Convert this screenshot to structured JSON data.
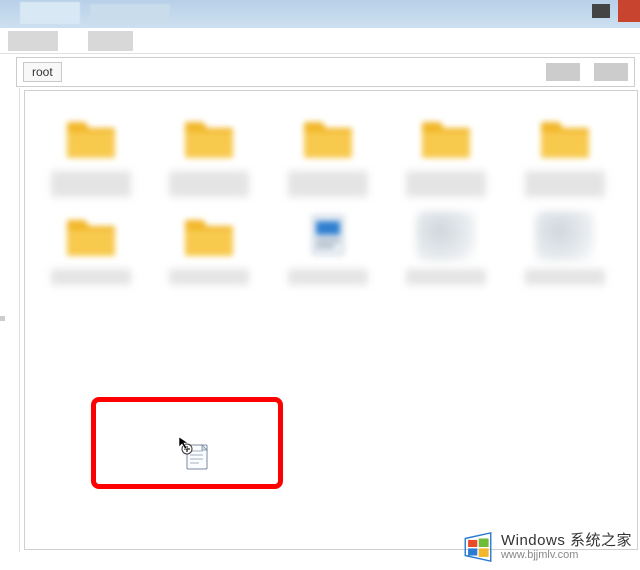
{
  "breadcrumb": {
    "root_label": "root"
  },
  "items": [
    {
      "kind": "folder",
      "label": ""
    },
    {
      "kind": "folder",
      "label": ""
    },
    {
      "kind": "folder",
      "label": ""
    },
    {
      "kind": "folder",
      "label": ""
    },
    {
      "kind": "folder",
      "label": ""
    },
    {
      "kind": "folder",
      "label": ""
    },
    {
      "kind": "folder",
      "label": ""
    },
    {
      "kind": "blue-doc",
      "label": ""
    },
    {
      "kind": "grey",
      "label": ""
    },
    {
      "kind": "grey",
      "label": ""
    }
  ],
  "watermark": {
    "title": "Windows 系统之家",
    "url": "www.bjjmlv.com"
  },
  "colors": {
    "folder": "#f2b72a",
    "highlight": "#ff0000",
    "close": "#c8442e"
  }
}
